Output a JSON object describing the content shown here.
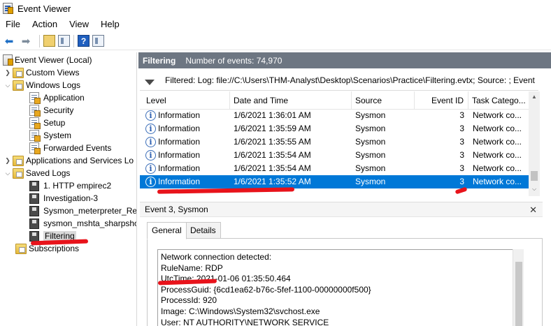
{
  "window": {
    "title": "Event Viewer"
  },
  "menu": [
    "File",
    "Action",
    "View",
    "Help"
  ],
  "tree": {
    "root": "Event Viewer (Local)",
    "custom_views": "Custom Views",
    "windows_logs": "Windows Logs",
    "application": "Application",
    "security": "Security",
    "setup": "Setup",
    "system": "System",
    "forwarded": "Forwarded Events",
    "apps_services": "Applications and Services Lo",
    "saved_logs": "Saved Logs",
    "saved_items": [
      "1. HTTP empirec2",
      "Investigation-3",
      "Sysmon_meterpreter_Ref",
      "sysmon_mshta_sharpsho",
      "Filtering"
    ],
    "subscriptions": "Subscriptions"
  },
  "main": {
    "title": "Filtering",
    "event_count": "Number of events: 74,970",
    "filter_text": "Filtered: Log: file://C:\\Users\\THM-Analyst\\Desktop\\Scenarios\\Practice\\Filtering.evtx; Source: ; Event"
  },
  "table": {
    "columns": [
      "Level",
      "Date and Time",
      "Source",
      "Event ID",
      "Task Catego..."
    ],
    "rows": [
      {
        "level": "Information",
        "datetime": "1/6/2021 1:36:01 AM",
        "source": "Sysmon",
        "event_id": "3",
        "task": "Network co..."
      },
      {
        "level": "Information",
        "datetime": "1/6/2021 1:35:59 AM",
        "source": "Sysmon",
        "event_id": "3",
        "task": "Network co..."
      },
      {
        "level": "Information",
        "datetime": "1/6/2021 1:35:55 AM",
        "source": "Sysmon",
        "event_id": "3",
        "task": "Network co..."
      },
      {
        "level": "Information",
        "datetime": "1/6/2021 1:35:54 AM",
        "source": "Sysmon",
        "event_id": "3",
        "task": "Network co..."
      },
      {
        "level": "Information",
        "datetime": "1/6/2021 1:35:54 AM",
        "source": "Sysmon",
        "event_id": "3",
        "task": "Network co..."
      },
      {
        "level": "Information",
        "datetime": "1/6/2021 1:35:52 AM",
        "source": "Sysmon",
        "event_id": "3",
        "task": "Network co..."
      }
    ],
    "selected_row": 5
  },
  "detail": {
    "title": "Event 3, Sysmon",
    "tabs": [
      "General",
      "Details"
    ],
    "lines": [
      "Network connection detected:",
      "RuleName: RDP",
      "UtcTime: 2021-01-06 01:35:50.464",
      "ProcessGuid: {6cd1ea62-b76c-5fef-1100-00000000f500}",
      "ProcessId: 920",
      "Image: C:\\Windows\\System32\\svchost.exe",
      "User: NT AUTHORITY\\NETWORK SERVICE"
    ]
  },
  "colors": {
    "header": "#6d7682",
    "selection": "#0078d7",
    "annotation": "#e8131b"
  }
}
